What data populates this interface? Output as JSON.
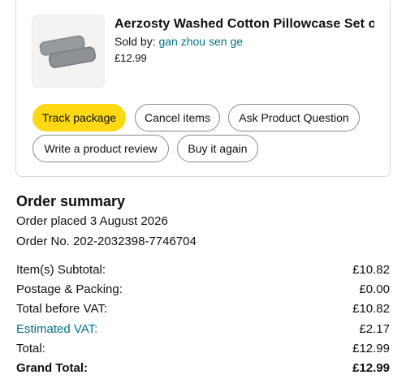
{
  "product": {
    "title": "Aerzosty Washed Cotton Pillowcase Set o...",
    "sold_by_prefix": "Sold by: ",
    "seller": "gan zhou sen ge",
    "price": "£12.99",
    "image": "grey-pillowcases-icon"
  },
  "actions": {
    "track_package": "Track package",
    "cancel_items": "Cancel items",
    "ask_question": "Ask Product Question",
    "write_review": "Write a product review",
    "buy_again": "Buy it again"
  },
  "colors": {
    "primary_button": "#ffd814",
    "link": "#007185",
    "border": "#d5d9d9"
  },
  "summary": {
    "title": "Order summary",
    "placed": "Order placed 3 August 2026",
    "order_no": "Order No. 202-2032398-7746704",
    "rows": [
      {
        "label": "Item(s) Subtotal:",
        "value": "£10.82"
      },
      {
        "label": "Postage & Packing:",
        "value": "£0.00"
      },
      {
        "label": "Total before VAT:",
        "value": "£10.82"
      },
      {
        "label": "Estimated VAT:",
        "value": "£2.17"
      },
      {
        "label": "Total:",
        "value": "£12.99"
      },
      {
        "label": "Grand Total:",
        "value": "£12.99"
      }
    ]
  }
}
